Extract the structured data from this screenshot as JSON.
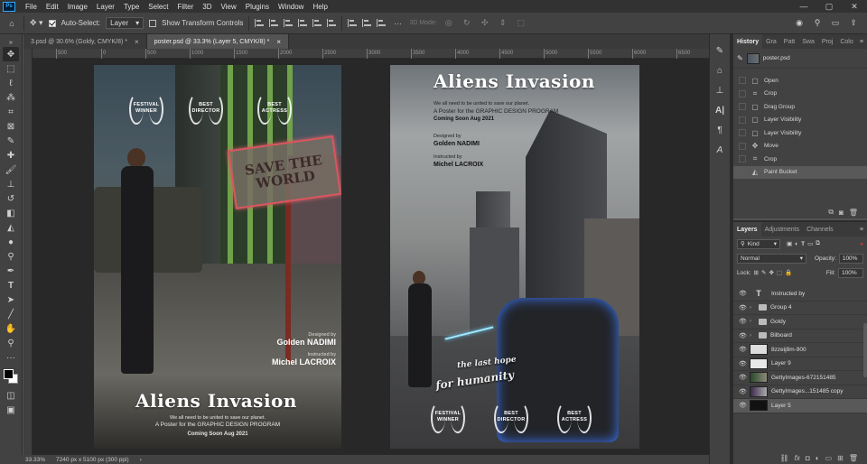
{
  "menubar": {
    "logo": "Ps",
    "items": [
      "File",
      "Edit",
      "Image",
      "Layer",
      "Type",
      "Select",
      "Filter",
      "3D",
      "View",
      "Plugins",
      "Window",
      "Help"
    ],
    "win_minimize": "—",
    "win_maximize": "▢",
    "win_close": "✕"
  },
  "options_bar": {
    "auto_select_label": "Auto-Select:",
    "auto_select_checked": true,
    "auto_select_value": "Layer",
    "show_transform_label": "Show Transform Controls",
    "show_transform_checked": false,
    "mode_3d_label": "3D Mode:",
    "more": "···"
  },
  "tabs": [
    {
      "label": "3.psd @ 30.6% (Goldy, CMYK/8) *",
      "active": false
    },
    {
      "label": "poster.psd @ 33.3% (Layer 5, CMYK/8) *",
      "active": true
    }
  ],
  "ruler": {
    "ticks": [
      "500",
      "0",
      "500",
      "1000",
      "1500",
      "2000",
      "2500",
      "3000",
      "3500",
      "4000",
      "4500",
      "5000",
      "5500",
      "6000",
      "6500",
      "7000"
    ]
  },
  "poster_left": {
    "laurels": [
      {
        "line1": "FESTIVAL",
        "line2": "WINNER"
      },
      {
        "line1": "BEST",
        "line2": "DIRECTOR"
      },
      {
        "line1": "BEST",
        "line2": "ACTRESS"
      }
    ],
    "sign_line1": "SAVE THE",
    "sign_line2": "WORLD",
    "designed_by_label": "Designed by",
    "designer": "Golden NADIMI",
    "instructed_by_label": "Instructed by",
    "instructor": "Michel LACROIX",
    "title": "Aliens Invasion",
    "tagline": "We all need to be united to save our planet.",
    "subtitle": "A Poster for the GRAPHIC DESIGN PROGRAM",
    "coming_soon": "Coming Soon Aug 2021"
  },
  "poster_right": {
    "title": "Aliens Invasion",
    "tagline": "We all need to be united to save our planet.",
    "subtitle": "A Poster for the GRAPHIC DESIGN PROGRAM",
    "coming_soon": "Coming Soon Aug 2021",
    "designed_by_label": "Designed by",
    "designer": "Golden NADIMI",
    "instructed_by_label": "Instructed by",
    "instructor": "Michel LACROIX",
    "overlay_line1": "the last hope",
    "overlay_line2": "for humanity",
    "laurels": [
      {
        "line1": "FESTIVAL",
        "line2": "WINNER"
      },
      {
        "line1": "BEST",
        "line2": "DIRECTOR"
      },
      {
        "line1": "BEST",
        "line2": "ACTRESS"
      }
    ]
  },
  "statusbar": {
    "zoom": "33.33%",
    "doc_info": "7240 px x 5100 px (300 ppi)"
  },
  "history": {
    "tabs": [
      "History",
      "Gra",
      "Patt",
      "Swa",
      "Proj",
      "Colo"
    ],
    "menu": "≡",
    "snapshot": "poster.psd",
    "items": [
      {
        "label": "Open",
        "active": false
      },
      {
        "label": "Crop",
        "active": false
      },
      {
        "label": "Drag Group",
        "active": false
      },
      {
        "label": "Layer Visibility",
        "active": false
      },
      {
        "label": "Layer Visibility",
        "active": false
      },
      {
        "label": "Move",
        "active": false
      },
      {
        "label": "Crop",
        "active": false
      },
      {
        "label": "Paint Bucket",
        "active": true
      }
    ]
  },
  "layers": {
    "tabs": [
      "Layers",
      "Adjustments",
      "Channels"
    ],
    "menu": "≡",
    "kind": "Kind",
    "blend_mode": "Normal",
    "opacity_label": "Opacity:",
    "opacity_value": "100%",
    "lock_label": "Lock:",
    "fill_label": "Fill:",
    "fill_value": "100%",
    "items": [
      {
        "name": "Instructed by",
        "type": "text",
        "active": false
      },
      {
        "name": "Group 4",
        "type": "group",
        "active": false
      },
      {
        "name": "Goldy",
        "type": "group",
        "active": false
      },
      {
        "name": "Bilboard",
        "type": "group",
        "active": false
      },
      {
        "name": "8zzeij8m-900",
        "type": "pixel",
        "active": false
      },
      {
        "name": "Layer 9",
        "type": "pixel",
        "active": false
      },
      {
        "name": "GettyImages-672151485",
        "type": "pixel",
        "active": false
      },
      {
        "name": "GettyImages...151485 copy",
        "type": "pixel",
        "active": false
      },
      {
        "name": "Layer 5",
        "type": "pixel",
        "active": true
      }
    ]
  },
  "colors": {
    "sign_neon": "#d9565e",
    "alien_glow": "#3f7bff"
  }
}
